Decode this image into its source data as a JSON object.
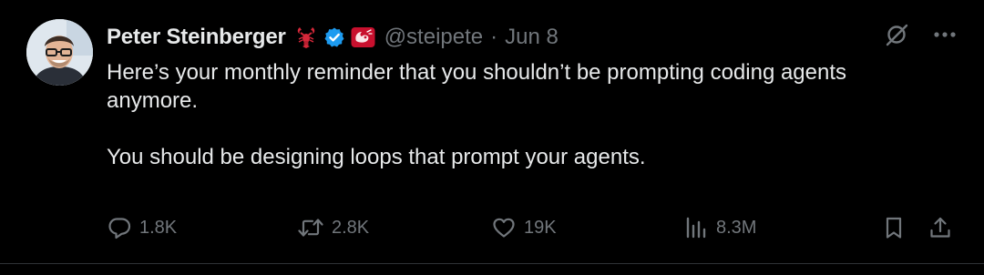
{
  "author": {
    "display_name": "Peter Steinberger",
    "handle": "@steipete",
    "separator": "·",
    "date": "Jun 8",
    "verified_color": "#1d9bf0"
  },
  "tweet": {
    "paragraphs": [
      "Here’s your monthly reminder that you shouldn’t be prompting coding agents anymore.",
      "You should be designing loops that prompt your agents."
    ]
  },
  "metrics": {
    "replies": "1.8K",
    "reposts": "2.8K",
    "likes": "19K",
    "views": "8.3M"
  },
  "icons": {
    "reply": "comment-icon",
    "repost": "repost-icon",
    "like": "heart-icon",
    "views": "views-chart-icon",
    "bookmark": "bookmark-icon",
    "share": "share-icon",
    "grok": "grok-icon",
    "more": "more-dots-icon"
  },
  "colors": {
    "background": "#000000",
    "text": "#e7e9ea",
    "muted": "#71767b",
    "accent": "#1d9bf0",
    "lobster": "#d5283a"
  }
}
